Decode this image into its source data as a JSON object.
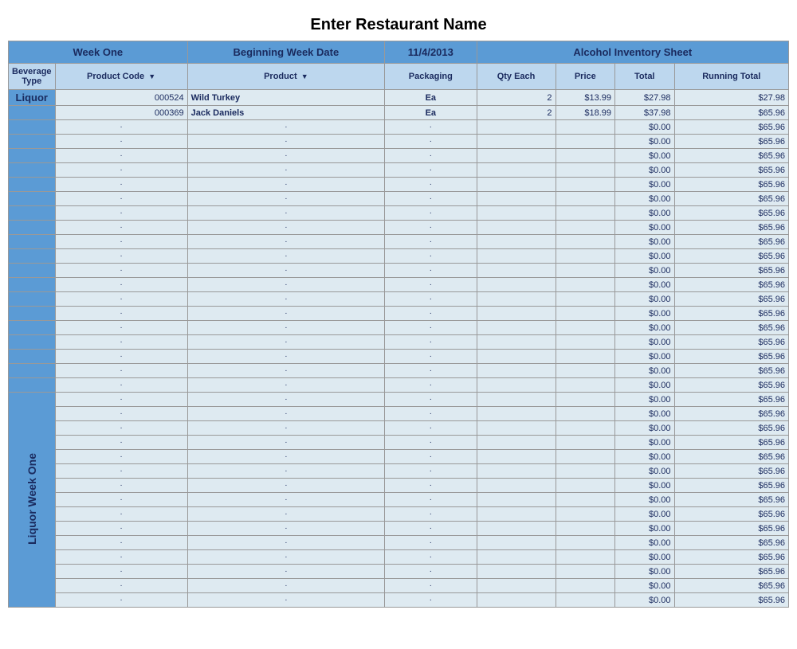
{
  "title": "Enter Restaurant Name",
  "header_row1": {
    "week_one": "Week One",
    "beginning_week_date_label": "Beginning Week Date",
    "date_value": "11/4/2013",
    "alcohol_inventory": "Alcohol Inventory Sheet"
  },
  "header_row2": {
    "beverage_type": "Beverage Type",
    "product_code": "Product Code",
    "product": "Product",
    "packaging": "Packaging",
    "qty_each": "Qty Each",
    "price": "Price",
    "total": "Total",
    "running_total": "Running Total"
  },
  "data_rows": [
    {
      "bev_type": "Liquor",
      "code": "000524",
      "product": "Wild Turkey",
      "packaging": "Ea",
      "qty": "2",
      "price": "$13.99",
      "total": "$27.98",
      "running_total": "$27.98",
      "is_first": true
    },
    {
      "code": "000369",
      "product": "Jack Daniels",
      "packaging": "Ea",
      "qty": "2",
      "price": "$18.99",
      "total": "$37.98",
      "running_total": "$65.96"
    }
  ],
  "empty_rows_total": "$0.00",
  "empty_rows_running": "$65.96",
  "rotated_label": "Liquor Week One",
  "dot": "·"
}
